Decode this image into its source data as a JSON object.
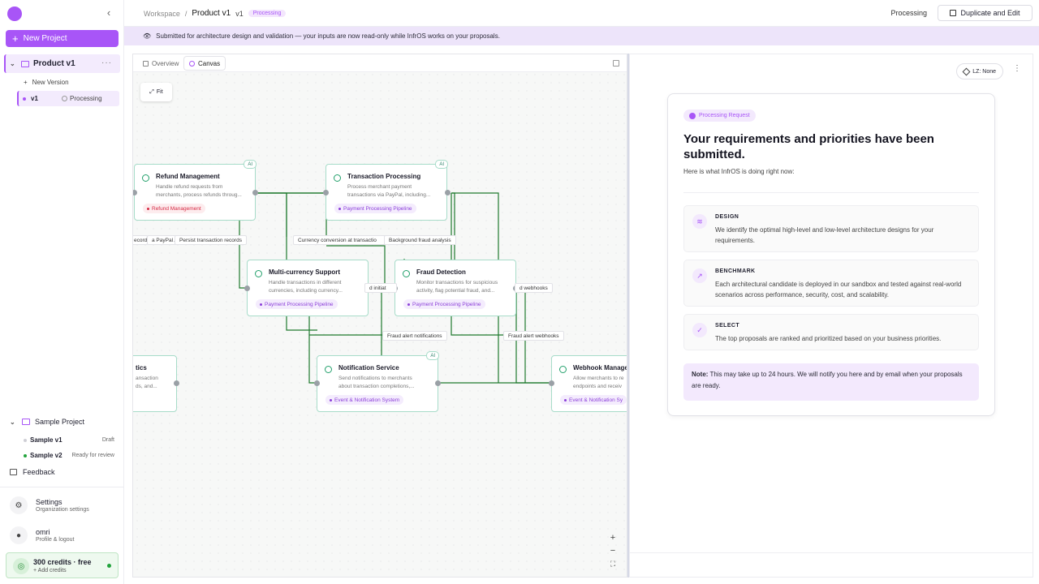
{
  "sidebar": {
    "new_project": "New Project",
    "project": {
      "name": "Product v1",
      "menu": "···"
    },
    "new_version": "New Version",
    "version": {
      "label": "v1",
      "status": "Processing"
    },
    "sample_project": {
      "name": "Sample Project",
      "items": [
        {
          "label": "Sample v1",
          "status": "Draft"
        },
        {
          "label": "Sample v2",
          "status": "Ready for review"
        }
      ]
    },
    "feedback": "Feedback",
    "settings": {
      "title": "Settings",
      "subtitle": "Organization settings"
    },
    "user": {
      "title": "omri",
      "subtitle": "Profile & logout"
    },
    "credits": {
      "title": "300 credits · free",
      "subtitle": "+ Add credits"
    }
  },
  "header": {
    "breadcrumb_root": "Workspace",
    "breadcrumb_sep": "/",
    "breadcrumb_current": "Product v1",
    "version": "v1",
    "badge": "Processing",
    "status": "Processing",
    "duplicate_button": "Duplicate and Edit"
  },
  "banner": {
    "text": "Submitted for architecture design and validation — your inputs are now read-only while InfrOS works on your proposals."
  },
  "canvas": {
    "tabs": [
      {
        "label": "Overview"
      },
      {
        "label": "Canvas"
      }
    ],
    "fit_button": "Fit",
    "nodes": [
      {
        "title": "Refund Management",
        "desc1": "Handle refund requests from",
        "desc2": "merchants, process refunds throug...",
        "tag": "Refund Management",
        "ai": "AI"
      },
      {
        "title": "Transaction Processing",
        "desc1": "Process merchant payment",
        "desc2": "transactions via PayPal, including...",
        "tag": "Payment Processing Pipeline",
        "ai": "AI"
      },
      {
        "title": "Multi-currency Support",
        "desc1": "Handle transactions in different",
        "desc2": "currencies, including currency...",
        "tag": "Payment Processing Pipeline"
      },
      {
        "title": "Fraud Detection",
        "desc1": "Monitor transactions for suspicious",
        "desc2": "activity, flag potential fraud, and...",
        "tag": "Payment Processing Pipeline"
      },
      {
        "title": "tics",
        "desc1": "ansaction",
        "desc2": "ds, and..."
      },
      {
        "title": "Notification Service",
        "desc1": "Send notifications to merchants",
        "desc2": "about transaction completions,...",
        "tag": "Event & Notification System",
        "ai": "AI"
      },
      {
        "title": "Webhook Manage",
        "desc1": "Allow merchants to re",
        "desc2": "endpoints and receiv",
        "tag": "Event & Notification Sy"
      }
    ],
    "edge_labels": [
      "ecords",
      "a PayPal A",
      "Persist transaction records",
      "Currency conversion at transactio",
      "Background fraud analysis",
      "d initiat",
      "d webhooks",
      "Fraud alert notifications",
      "Fraud alert webhooks"
    ],
    "zoom_in": "+",
    "zoom_out": "−",
    "fullscreen": "⛶"
  },
  "right_panel": {
    "lz_button": "LZ: None",
    "badge": "Processing Request",
    "title": "Your requirements and priorities have been submitted.",
    "subtitle": "Here is what InfrOS is doing right now:",
    "steps": [
      {
        "heading": "DESIGN",
        "body": "We identify the optimal high-level and low-level architecture designs for your requirements."
      },
      {
        "heading": "BENCHMARK",
        "body": "Each architectural candidate is deployed in our sandbox and tested against real-world scenarios across performance, security, cost, and scalability."
      },
      {
        "heading": "SELECT",
        "body": "The top proposals are ranked and prioritized based on your business priorities."
      }
    ],
    "note_label": "Note:",
    "note_text": "This may take up to 24 hours. We will notify you here and by email when your proposals are ready."
  },
  "colors": {
    "accent": "#a855f7",
    "node_border": "#a7dcc9",
    "edge": "#1f7a2e",
    "banner": "#ede4fa"
  }
}
